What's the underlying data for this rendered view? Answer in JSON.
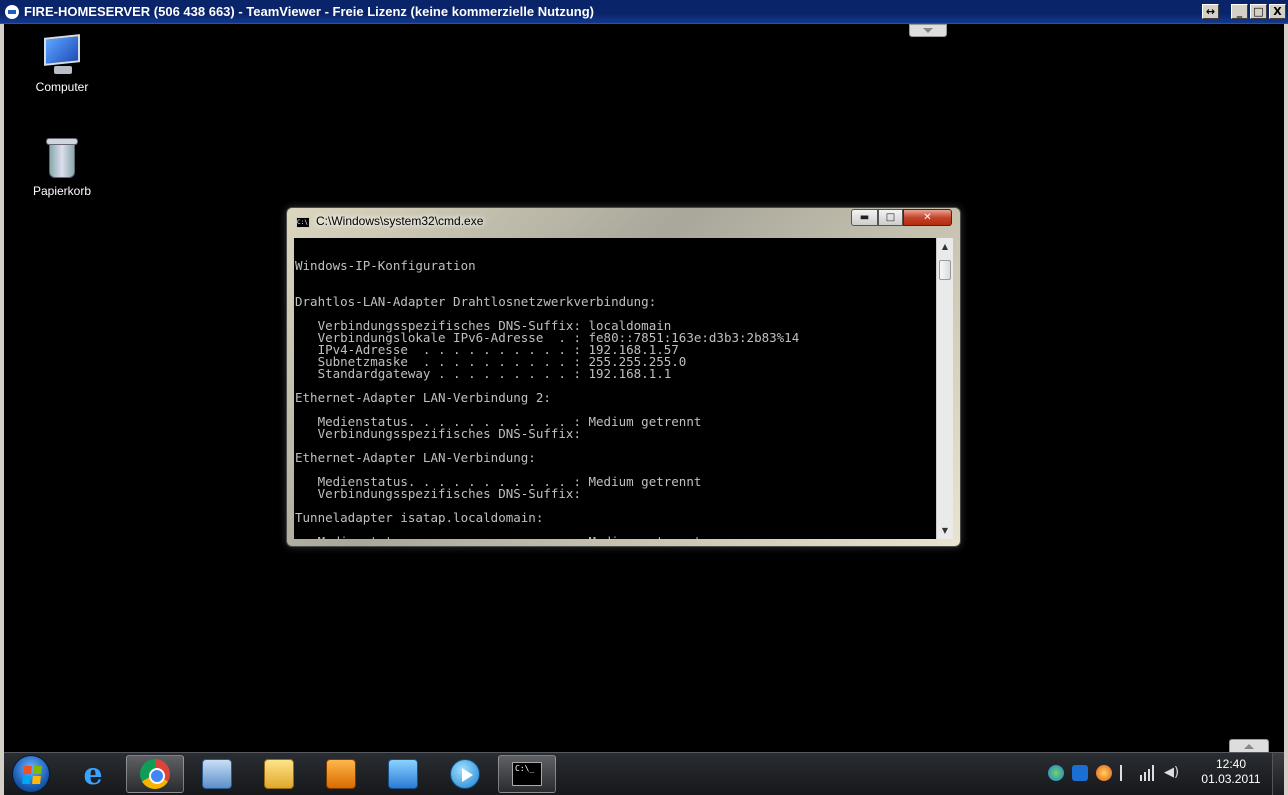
{
  "teamviewer": {
    "title": "FIRE-HOMESERVER (506 438 663) - TeamViewer - Freie Lizenz (keine kommerzielle Nutzung)",
    "fit_icon": "↔",
    "minimize": "_",
    "maximize": "□",
    "close": "X"
  },
  "desktop": {
    "icons": [
      {
        "label": "Computer",
        "icon": "computer-icon"
      },
      {
        "label": "Papierkorb",
        "icon": "recycle-bin-icon"
      }
    ]
  },
  "cmd": {
    "title": "C:\\Windows\\system32\\cmd.exe",
    "icon_text": "C:\\",
    "minimize": "▬",
    "maximize": "□",
    "close": "✕",
    "lines": [
      "",
      "Windows-IP-Konfiguration",
      "",
      "",
      "Drahtlos-LAN-Adapter Drahtlosnetzwerkverbindung:",
      "",
      "   Verbindungsspezifisches DNS-Suffix: localdomain",
      "   Verbindungslokale IPv6-Adresse  . : fe80::7851:163e:d3b3:2b83%14",
      "   IPv4-Adresse  . . . . . . . . . . : 192.168.1.57",
      "   Subnetzmaske  . . . . . . . . . . : 255.255.255.0",
      "   Standardgateway . . . . . . . . . : 192.168.1.1",
      "",
      "Ethernet-Adapter LAN-Verbindung 2:",
      "",
      "   Medienstatus. . . . . . . . . . . : Medium getrennt",
      "   Verbindungsspezifisches DNS-Suffix:",
      "",
      "Ethernet-Adapter LAN-Verbindung:",
      "",
      "   Medienstatus. . . . . . . . . . . : Medium getrennt",
      "   Verbindungsspezifisches DNS-Suffix:",
      "",
      "Tunneladapter isatap.localdomain:",
      "",
      "   Medienstatus. . . . . . . . . . . : Medium getrennt"
    ],
    "scroll_up": "▲",
    "scroll_down": "▼"
  },
  "taskbar": {
    "items": [
      {
        "name": "internet-explorer",
        "icon": "internet-explorer-icon",
        "glyph": "e"
      },
      {
        "name": "chrome",
        "icon": "chrome-icon",
        "active": true
      },
      {
        "name": "remote-desktop",
        "icon": "remote-desktop-icon"
      },
      {
        "name": "explorer",
        "icon": "folder-icon"
      },
      {
        "name": "media-center",
        "icon": "media-icon"
      },
      {
        "name": "network",
        "icon": "network-icon"
      },
      {
        "name": "media-player",
        "icon": "media-player-icon"
      },
      {
        "name": "cmd",
        "icon": "cmd-icon",
        "glyph": "C:\\_",
        "active": true
      }
    ],
    "time": "12:40",
    "date": "01.03.2011"
  },
  "colors": {
    "console_text": "#c0c0c0",
    "desktop_bg": "#000000",
    "tv_title_bg": "#0a246a"
  }
}
